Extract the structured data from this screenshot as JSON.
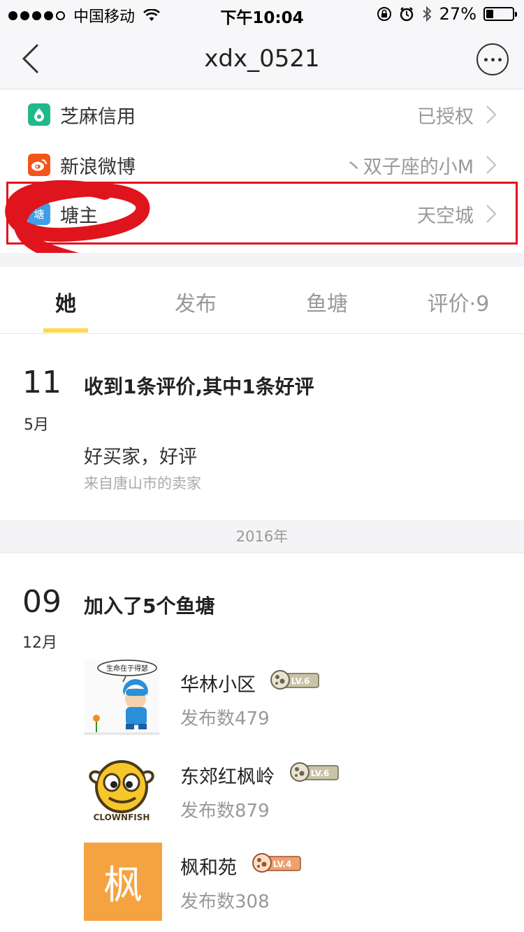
{
  "status_bar": {
    "carrier": "中国移动",
    "time": "下午10:04",
    "battery": "27%",
    "battery_level": 0.27
  },
  "navbar": {
    "title": "xdx_0521"
  },
  "accounts": [
    {
      "label": "芝麻信用",
      "value": "已授权",
      "icon": "sesame-credit-icon",
      "color": "#1fb98c"
    },
    {
      "label": "新浪微博",
      "value": "丶双子座的小M",
      "icon": "weibo-icon",
      "color": "#f2541a"
    },
    {
      "label": "塘主",
      "value": "天空城",
      "icon": "pond-owner-icon",
      "icon_text": "塘",
      "color": "#3f9ee8"
    }
  ],
  "tabs": [
    {
      "label": "她",
      "active": true
    },
    {
      "label": "发布"
    },
    {
      "label": "鱼塘"
    },
    {
      "label": "评价·9"
    }
  ],
  "timeline": {
    "event1": {
      "day": "11",
      "month": "5月",
      "title": "收到1条评价,其中1条好评",
      "review": "好买家，好评",
      "source": "来自唐山市的卖家"
    },
    "year_separator": "2016年",
    "event2": {
      "day": "09",
      "month": "12月",
      "title": "加入了5个鱼塘"
    }
  },
  "ponds": [
    {
      "name": "华林小区",
      "count": "发布数479",
      "level": "LV.6",
      "thumb_caption": "生命在于得瑟"
    },
    {
      "name": "东郊红枫岭",
      "count": "发布数879",
      "level": "LV.6",
      "thumb_caption": "CLOWNFISH"
    },
    {
      "name": "枫和苑",
      "count": "发布数308",
      "level": "LV.4",
      "thumb_char": "枫"
    }
  ],
  "colors": {
    "accent_yellow": "#ffda44",
    "highlight_red": "#e0141c",
    "pond_orange": "#f5a340"
  }
}
